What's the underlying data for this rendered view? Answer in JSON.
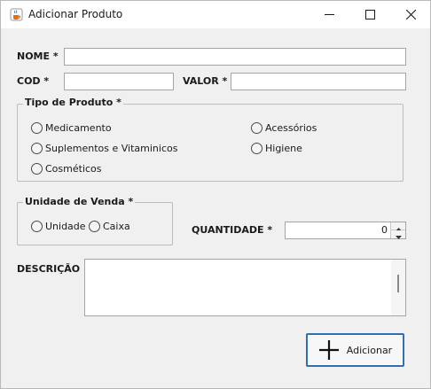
{
  "window": {
    "title": "Adicionar Produto",
    "icon": "java-cup-icon",
    "controls": [
      "minimize-icon",
      "maximize-icon",
      "close-icon"
    ]
  },
  "form": {
    "nome_label": "NOME *",
    "nome_value": "",
    "cod_label": "COD *",
    "cod_value": "",
    "valor_label": "VALOR *",
    "valor_value": "",
    "tipo_group": {
      "title": "Tipo de Produto *",
      "options": [
        "Medicamento",
        "Suplementos e Vitaminicos",
        "Cosméticos",
        "Acessórios",
        "Higiene"
      ]
    },
    "unidade_group": {
      "title": "Unidade de Venda *",
      "options": [
        "Unidade",
        "Caixa"
      ]
    },
    "quantidade_label": "QUANTIDADE *",
    "quantidade_value": "0",
    "descricao_label": "DESCRIÇÃO",
    "descricao_value": "",
    "add_button_label": "Adicionar",
    "add_button_icon": "plus-icon"
  },
  "colors": {
    "background": "#f0f0f0",
    "focus_border": "#2f6fb5"
  }
}
